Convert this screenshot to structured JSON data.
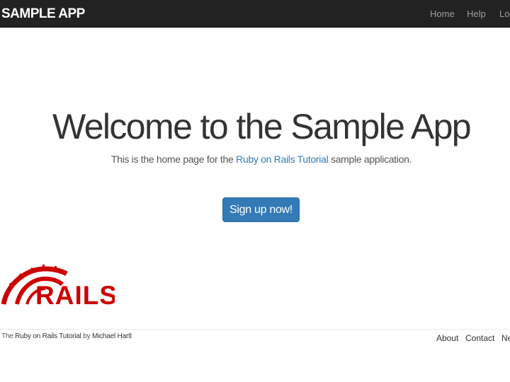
{
  "header": {
    "brand": "SAMPLE APP",
    "nav": [
      "Home",
      "Help",
      "Log in"
    ]
  },
  "hero": {
    "title": "Welcome to the Sample App",
    "subtitle_before": "This is the home page for the ",
    "subtitle_link": "Ruby on Rails Tutorial",
    "subtitle_after": " sample application.",
    "signup_label": "Sign up now!"
  },
  "logo": {
    "text": "RAILS",
    "icon": "rails-logo"
  },
  "footer": {
    "text_before": "The ",
    "tutorial_link": "Ruby on Rails Tutorial",
    "text_mid": " by ",
    "author_link": "Michael Hartl",
    "links": [
      "About",
      "Contact",
      "News"
    ]
  },
  "colors": {
    "navbar": "#222222",
    "link": "#337ab7",
    "button": "#337ab7",
    "rails_red": "#cc0000"
  }
}
